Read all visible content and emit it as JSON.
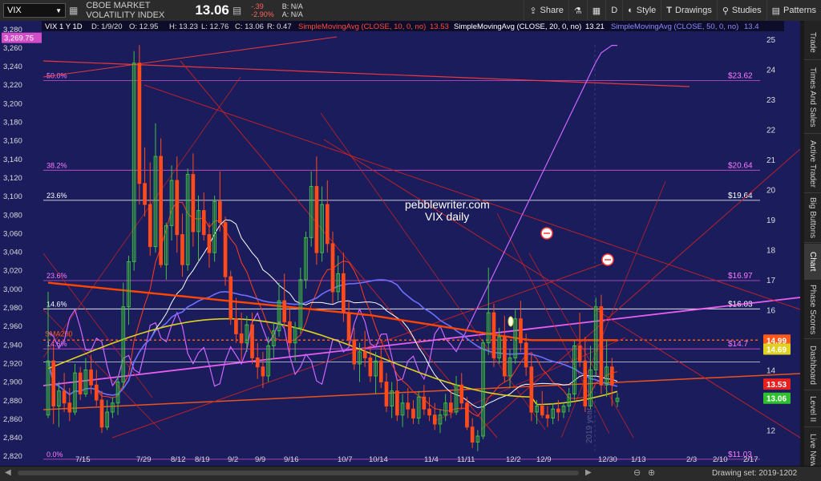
{
  "toolbar": {
    "symbol": "VIX",
    "description": "CBOE MARKET VOLATILITY INDEX",
    "last": "13.06",
    "change": "-.39",
    "change_pct": "-2.90%",
    "bid": "B: N/A",
    "ask": "A: N/A",
    "share": "Share",
    "aggregation": "D",
    "style": "Style",
    "drawings": "Drawings",
    "studies": "Studies",
    "patterns": "Patterns"
  },
  "info": {
    "sym": "VIX 1 Y 1D",
    "date": "D: 1/9/20",
    "open": "O: 12.95",
    "high": "H: 13.23",
    "low": "L: 12.76",
    "close": "C: 13.06",
    "range": "R: 0.47",
    "sma10": "SimpleMovingAvg (CLOSE, 10, 0, no)",
    "sma10_val": "13.53",
    "sma20": "SimpleMovingAvg (CLOSE, 20, 0, no)",
    "sma20_val": "13.21",
    "sma50": "SimpleMovingAvg (CLOSE, 50, 0, no)",
    "sma50_val": "13.4"
  },
  "sidebar": [
    "Trade",
    "Times And Sales",
    "Active Trader",
    "Big Buttons",
    "Chart",
    "Phase Scores",
    "Dashboard",
    "Level II",
    "Live News"
  ],
  "annotation": {
    "line1": "pebblewriter.com",
    "line2": "VIX daily",
    "year": "2019 year"
  },
  "bottom": {
    "drawing_set": "Drawing set: 2019-1202"
  },
  "colors": {
    "bg": "#1b1c5c",
    "up": "#3fbf3f",
    "down": "#ff4a1a",
    "sma10": "#ff3b1a",
    "sma20": "#ffffff",
    "sma50": "#6f6fff",
    "sma200": "#ff4500",
    "spx": "#cc66ff"
  },
  "chart_data": {
    "type": "candlestick",
    "title": "VIX 1 Y 1D",
    "ylim_left": [
      2815,
      3285
    ],
    "ylim_right": [
      11,
      25.5
    ],
    "left_axis_ticks": [
      "2,820",
      "2,840",
      "2,860",
      "2,880",
      "2,900",
      "2,920",
      "2,940",
      "2,960",
      "2,980",
      "3,000",
      "3,020",
      "3,040",
      "3,060",
      "3,080",
      "3,100",
      "3,120",
      "3,140",
      "3,160",
      "3,180",
      "3,200",
      "3,220",
      "3,240",
      "3,260",
      "3,280"
    ],
    "right_axis_ticks": [
      "12",
      "13",
      "14",
      "15",
      "16",
      "17",
      "18",
      "19",
      "20",
      "21",
      "22",
      "23",
      "24",
      "25"
    ],
    "x_ticks": [
      "7/15",
      "7/29",
      "8/12",
      "8/19",
      "9/2",
      "9/9",
      "9/16",
      "10/7",
      "10/14",
      "11/4",
      "11/11",
      "12/2",
      "12/9",
      "12/30",
      "1/13",
      "2/3",
      "2/10",
      "2/17"
    ],
    "left_price_label": "3,269.75",
    "fib_levels": [
      {
        "label": "50.0%",
        "value": "$23.62",
        "vix": 23.62
      },
      {
        "label": "38.2%",
        "value": "$20.64",
        "vix": 20.64
      },
      {
        "label": "23.6%",
        "value": "$19.64",
        "vix": 19.64
      },
      {
        "label": "23.6%",
        "value": "$16.97",
        "vix": 16.97
      },
      {
        "label": "14.6%",
        "value": "$16.03",
        "vix": 16.03
      },
      {
        "label": "14.6%",
        "value": "$14.7",
        "vix": 14.7
      },
      {
        "label": "0.0%",
        "value": "$11.03",
        "vix": 11.03
      }
    ],
    "sma200_label": "SMA200",
    "price_tags": [
      {
        "value": "14.99",
        "vix": 14.99,
        "color": "#ff5a1a"
      },
      {
        "value": "14.69",
        "vix": 14.69,
        "color": "#e0d020"
      },
      {
        "value": "13.53",
        "vix": 13.53,
        "color": "#e82020"
      },
      {
        "value": "13.06",
        "vix": 13.06,
        "color": "#2fbf2f"
      }
    ],
    "candles": [
      [
        12.5,
        16.6,
        12.4,
        14.3
      ],
      [
        14.3,
        14.8,
        12.2,
        12.8
      ],
      [
        12.8,
        13.6,
        12.1,
        13.3
      ],
      [
        13.3,
        13.9,
        12.6,
        12.9
      ],
      [
        12.9,
        13.4,
        12.3,
        12.6
      ],
      [
        12.6,
        14.2,
        12.5,
        13.9
      ],
      [
        13.9,
        14.1,
        13.0,
        13.2
      ],
      [
        13.2,
        14.4,
        13.1,
        14.0
      ],
      [
        14.0,
        14.5,
        13.2,
        13.5
      ],
      [
        13.5,
        14.0,
        12.8,
        13.0
      ],
      [
        13.0,
        13.3,
        11.9,
        12.1
      ],
      [
        12.1,
        13.0,
        12.0,
        12.6
      ],
      [
        12.6,
        13.1,
        12.4,
        12.9
      ],
      [
        12.9,
        13.8,
        12.5,
        13.6
      ],
      [
        13.6,
        16.9,
        13.4,
        16.1
      ],
      [
        16.1,
        17.8,
        15.5,
        17.6
      ],
      [
        17.6,
        24.6,
        17.3,
        24.2
      ],
      [
        24.2,
        24.8,
        19.5,
        20.2
      ],
      [
        20.2,
        21.4,
        19.1,
        19.5
      ],
      [
        19.5,
        20.9,
        17.8,
        18.1
      ],
      [
        18.1,
        22.2,
        17.9,
        21.1
      ],
      [
        21.1,
        21.7,
        17.4,
        17.5
      ],
      [
        17.5,
        18.9,
        17.0,
        18.8
      ],
      [
        18.8,
        20.8,
        18.3,
        20.3
      ],
      [
        20.3,
        21.1,
        17.9,
        18.5
      ],
      [
        18.5,
        19.2,
        17.1,
        17.5
      ],
      [
        17.5,
        20.7,
        17.3,
        20.5
      ],
      [
        20.5,
        21.2,
        18.1,
        18.6
      ],
      [
        18.6,
        19.8,
        17.6,
        19.3
      ],
      [
        19.3,
        19.9,
        18.3,
        18.5
      ],
      [
        18.5,
        18.9,
        17.4,
        17.9
      ],
      [
        17.9,
        19.8,
        17.6,
        19.6
      ],
      [
        19.6,
        20.6,
        18.6,
        18.9
      ],
      [
        18.9,
        19.1,
        16.8,
        17.1
      ],
      [
        17.1,
        17.3,
        15.5,
        15.7
      ],
      [
        15.7,
        16.4,
        14.9,
        15.2
      ],
      [
        15.2,
        15.9,
        14.3,
        14.9
      ],
      [
        14.9,
        15.8,
        14.6,
        15.5
      ],
      [
        15.5,
        15.9,
        14.2,
        14.4
      ],
      [
        14.4,
        14.9,
        13.7,
        14.1
      ],
      [
        14.1,
        14.6,
        13.4,
        13.8
      ],
      [
        13.8,
        15.1,
        13.6,
        14.8
      ],
      [
        14.8,
        15.6,
        14.4,
        15.3
      ],
      [
        15.3,
        16.9,
        15.1,
        16.3
      ],
      [
        16.3,
        17.2,
        15.4,
        15.6
      ],
      [
        15.6,
        16.1,
        14.6,
        14.9
      ],
      [
        14.9,
        15.6,
        14.3,
        15.4
      ],
      [
        15.4,
        17.4,
        15.2,
        17.0
      ],
      [
        17.0,
        18.6,
        16.7,
        18.4
      ],
      [
        18.4,
        20.6,
        18.1,
        20.1
      ],
      [
        20.1,
        21.1,
        17.5,
        17.9
      ],
      [
        17.9,
        20.1,
        17.6,
        19.5
      ],
      [
        19.5,
        20.3,
        17.9,
        18.2
      ],
      [
        18.2,
        18.6,
        16.2,
        16.6
      ],
      [
        16.6,
        17.8,
        16.3,
        17.2
      ],
      [
        17.2,
        17.9,
        15.6,
        15.9
      ],
      [
        15.9,
        16.3,
        14.8,
        15.0
      ],
      [
        15.0,
        15.4,
        14.0,
        14.2
      ],
      [
        14.2,
        14.9,
        13.6,
        14.6
      ],
      [
        14.6,
        15.3,
        14.1,
        14.4
      ],
      [
        14.4,
        14.8,
        13.6,
        13.8
      ],
      [
        13.8,
        14.6,
        13.2,
        14.3
      ],
      [
        14.3,
        14.8,
        13.4,
        13.6
      ],
      [
        13.6,
        13.9,
        12.6,
        12.8
      ],
      [
        12.8,
        13.6,
        12.4,
        13.3
      ],
      [
        13.3,
        13.7,
        12.3,
        12.5
      ],
      [
        12.5,
        13.2,
        12.1,
        12.9
      ],
      [
        12.9,
        13.4,
        12.4,
        12.7
      ],
      [
        12.7,
        13.0,
        12.2,
        12.4
      ],
      [
        12.4,
        13.3,
        12.2,
        13.1
      ],
      [
        13.1,
        13.5,
        12.5,
        12.7
      ],
      [
        12.7,
        13.1,
        12.3,
        12.5
      ],
      [
        12.5,
        12.9,
        12.0,
        12.2
      ],
      [
        12.2,
        12.7,
        11.9,
        12.5
      ],
      [
        12.5,
        13.2,
        12.3,
        12.9
      ],
      [
        12.9,
        13.3,
        12.4,
        12.6
      ],
      [
        12.6,
        13.8,
        12.5,
        13.5
      ],
      [
        13.5,
        13.9,
        12.7,
        12.9
      ],
      [
        12.9,
        13.1,
        12.0,
        12.1
      ],
      [
        12.1,
        12.4,
        11.4,
        11.6
      ],
      [
        11.6,
        12.0,
        11.3,
        11.8
      ],
      [
        11.8,
        15.0,
        11.7,
        14.9
      ],
      [
        14.9,
        17.4,
        14.5,
        15.9
      ],
      [
        15.9,
        16.2,
        14.1,
        14.4
      ],
      [
        14.4,
        15.4,
        14.2,
        15.1
      ],
      [
        15.1,
        15.8,
        13.6,
        13.8
      ],
      [
        13.8,
        14.7,
        13.4,
        14.4
      ],
      [
        14.4,
        16.0,
        14.2,
        15.7
      ],
      [
        15.7,
        16.3,
        14.6,
        14.9
      ],
      [
        14.9,
        15.2,
        13.8,
        14.1
      ],
      [
        14.1,
        14.5,
        12.3,
        12.6
      ],
      [
        12.6,
        13.0,
        12.2,
        12.8
      ],
      [
        12.8,
        13.3,
        12.4,
        12.5
      ],
      [
        12.5,
        12.8,
        12.1,
        12.4
      ],
      [
        12.4,
        12.9,
        12.2,
        12.7
      ],
      [
        12.7,
        13.0,
        12.3,
        12.6
      ],
      [
        12.6,
        12.9,
        12.4,
        12.8
      ],
      [
        12.8,
        13.4,
        12.6,
        13.2
      ],
      [
        13.2,
        15.0,
        13.0,
        14.8
      ],
      [
        14.8,
        15.9,
        14.1,
        14.3
      ],
      [
        14.3,
        15.1,
        12.6,
        12.8
      ],
      [
        12.8,
        14.8,
        12.7,
        14.0
      ],
      [
        14.0,
        16.4,
        13.8,
        16.1
      ],
      [
        16.1,
        16.5,
        13.2,
        13.5
      ],
      [
        13.5,
        15.0,
        13.1,
        14.1
      ],
      [
        14.1,
        14.4,
        12.8,
        13.5
      ],
      [
        12.95,
        13.23,
        12.76,
        13.06
      ]
    ],
    "series": [
      {
        "name": "SimpleMovingAvg (CLOSE, 10, 0, no)",
        "color": "#ff3b1a"
      },
      {
        "name": "SimpleMovingAvg (CLOSE, 20, 0, no)",
        "color": "#ffffff"
      },
      {
        "name": "SimpleMovingAvg (CLOSE, 50, 0, no)",
        "color": "#6f6fff"
      },
      {
        "name": "SMA200",
        "color": "#ff4500"
      }
    ]
  }
}
